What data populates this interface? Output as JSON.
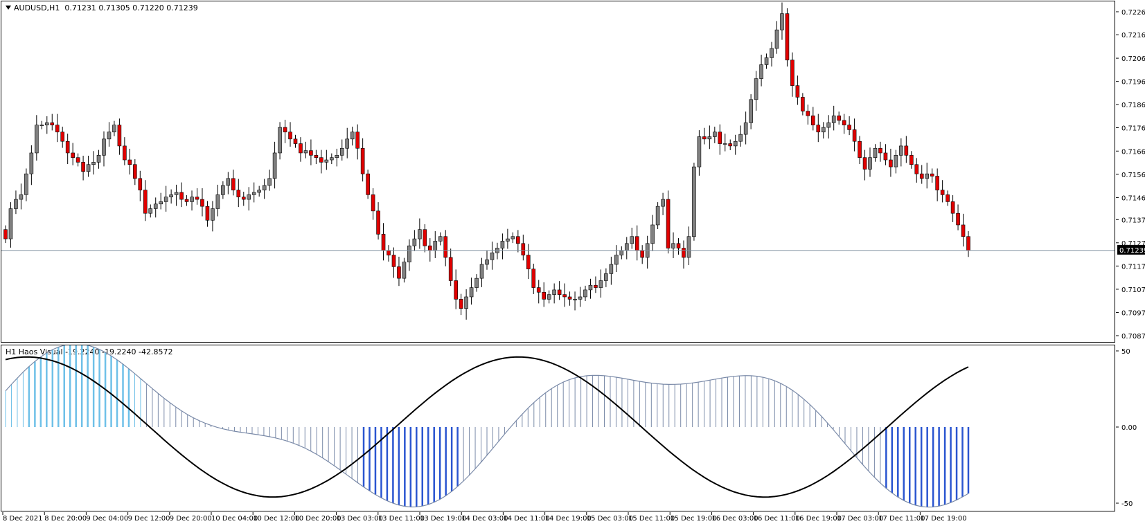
{
  "chart_header": {
    "symbol": "AUDUSD,H1",
    "ohlc": "0.71231 0.71305 0.71220 0.71239"
  },
  "indicator_header": {
    "name": "H1 Haos Visual",
    "values": "-19.2240 -19.2240 -42.8572"
  },
  "price_axis": [
    "0.72265",
    "0.72166",
    "0.72065",
    "0.71965",
    "0.71865",
    "0.71766",
    "0.71665",
    "0.71565",
    "0.71465",
    "0.71370",
    "0.71270",
    "0.71170",
    "0.71070",
    "0.70970",
    "0.70870"
  ],
  "current_price": "0.71239",
  "indicator_axis": [
    "50",
    "0.00",
    "-50"
  ],
  "time_axis": [
    "8 Dec 2021",
    "8 Dec 20:00",
    "9 Dec 04:00",
    "9 Dec 12:00",
    "9 Dec 20:00",
    "10 Dec 04:00",
    "10 Dec 12:00",
    "10 Dec 20:00",
    "13 Dec 03:00",
    "13 Dec 11:00",
    "13 Dec 19:00",
    "14 Dec 03:00",
    "14 Dec 11:00",
    "14 Dec 19:00",
    "15 Dec 03:00",
    "15 Dec 11:00",
    "15 Dec 19:00",
    "16 Dec 03:00",
    "16 Dec 11:00",
    "16 Dec 19:00",
    "17 Dec 03:00",
    "17 Dec 11:00",
    "17 Dec 19:00"
  ],
  "colors": {
    "bull": "#808080",
    "bear": "#e00000",
    "wick": "#000000",
    "histogram": "#7a8aa8",
    "histogram_strong": "#2a55d0",
    "histogram_light": "#6ec0e8",
    "signal_line": "#000000",
    "price_line": "#7f8f9f"
  },
  "chart_data": {
    "type": "candlestick",
    "series_name": "AUDUSD,H1",
    "ylim": [
      0.7087,
      0.72265
    ],
    "closes": [
      0.7129,
      0.7142,
      0.7146,
      0.7148,
      0.7157,
      0.7166,
      0.7178,
      0.7178,
      0.7179,
      0.7178,
      0.7175,
      0.7171,
      0.7166,
      0.7164,
      0.7162,
      0.7158,
      0.7161,
      0.7162,
      0.7165,
      0.7172,
      0.7175,
      0.7178,
      0.7169,
      0.7163,
      0.7161,
      0.7155,
      0.715,
      0.714,
      0.7142,
      0.7144,
      0.7145,
      0.7147,
      0.7148,
      0.7149,
      0.7146,
      0.7145,
      0.7147,
      0.7146,
      0.7143,
      0.7137,
      0.7142,
      0.7148,
      0.7152,
      0.7155,
      0.715,
      0.7147,
      0.7146,
      0.7148,
      0.7149,
      0.715,
      0.7152,
      0.7155,
      0.7166,
      0.7177,
      0.7175,
      0.7172,
      0.717,
      0.7166,
      0.7167,
      0.7165,
      0.7164,
      0.7162,
      0.7163,
      0.7164,
      0.7165,
      0.7168,
      0.7172,
      0.7175,
      0.7168,
      0.7157,
      0.7148,
      0.7141,
      0.7131,
      0.7124,
      0.7122,
      0.7117,
      0.7112,
      0.7119,
      0.7126,
      0.7129,
      0.7133,
      0.7126,
      0.7124,
      0.7128,
      0.713,
      0.7121,
      0.7111,
      0.7103,
      0.7099,
      0.7104,
      0.7108,
      0.7112,
      0.7118,
      0.712,
      0.7123,
      0.7125,
      0.7128,
      0.7129,
      0.713,
      0.7127,
      0.7122,
      0.7116,
      0.7108,
      0.7106,
      0.7103,
      0.7105,
      0.7107,
      0.7105,
      0.7104,
      0.7103,
      0.7103,
      0.7104,
      0.7107,
      0.7109,
      0.7108,
      0.7111,
      0.7114,
      0.7118,
      0.7122,
      0.7124,
      0.7127,
      0.713,
      0.7124,
      0.7121,
      0.7127,
      0.7135,
      0.7143,
      0.7146,
      0.7125,
      0.7127,
      0.7125,
      0.7121,
      0.713,
      0.716,
      0.7173,
      0.7172,
      0.7173,
      0.7175,
      0.717,
      0.717,
      0.7169,
      0.7171,
      0.7174,
      0.7179,
      0.7189,
      0.7198,
      0.7204,
      0.7207,
      0.7211,
      0.7219,
      0.7226,
      0.7206,
      0.7195,
      0.719,
      0.7184,
      0.7182,
      0.7178,
      0.7175,
      0.7177,
      0.7179,
      0.7182,
      0.718,
      0.7178,
      0.7176,
      0.7171,
      0.7164,
      0.7159,
      0.7164,
      0.7168,
      0.7166,
      0.7163,
      0.716,
      0.7165,
      0.7169,
      0.7165,
      0.7161,
      0.7157,
      0.7155,
      0.7157,
      0.7156,
      0.715,
      0.7148,
      0.7145,
      0.714,
      0.7135,
      0.713,
      0.7124
    ]
  }
}
